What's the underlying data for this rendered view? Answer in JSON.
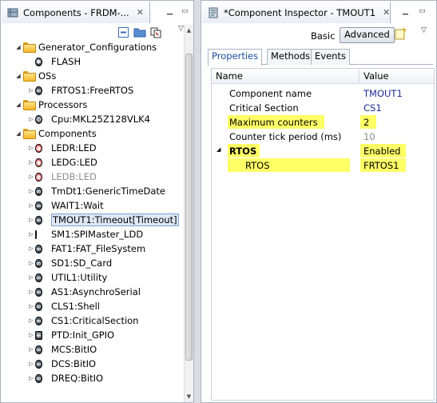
{
  "left_view": {
    "title": "Components - FRDM-...",
    "close": "✕",
    "toolbar_icons": [
      "collapse-all-icon",
      "folder-icon",
      "link-icon"
    ],
    "menu": "▽"
  },
  "tree": [
    {
      "label": "Generator_Configurations",
      "icon": "folder-icon",
      "expanded": true
    },
    {
      "label": "FLASH",
      "icon": "gear-icon"
    },
    {
      "label": "OSs",
      "icon": "folder-icon",
      "expanded": true
    },
    {
      "label": "FRTOS1:FreeRTOS",
      "icon": "component-icon",
      "expanded": false
    },
    {
      "label": "Processors",
      "icon": "folder-icon",
      "expanded": true
    },
    {
      "label": "Cpu:MKL25Z128VLK4",
      "icon": "cpu-icon",
      "expanded": false
    },
    {
      "label": "Components",
      "icon": "folder-icon",
      "expanded": true
    },
    {
      "label": "LEDR:LED",
      "icon": "led-icon",
      "expanded": false
    },
    {
      "label": "LEDG:LED",
      "icon": "led-icon",
      "expanded": false
    },
    {
      "label": "LEDB:LED",
      "icon": "led-icon",
      "expanded": false,
      "disabled": true
    },
    {
      "label": "TmDt1:GenericTimeDate",
      "icon": "component-icon",
      "expanded": false
    },
    {
      "label": "WAIT1:Wait",
      "icon": "component-icon",
      "expanded": false
    },
    {
      "label": "TMOUT1:Timeout[Timeout]",
      "icon": "component-icon",
      "expanded": false,
      "selected": true
    },
    {
      "label": "SM1:SPIMaster_LDD",
      "icon": "spi-icon",
      "expanded": false
    },
    {
      "label": "FAT1:FAT_FileSystem",
      "icon": "component-icon",
      "expanded": false
    },
    {
      "label": "SD1:SD_Card",
      "icon": "component-icon",
      "expanded": false
    },
    {
      "label": "UTIL1:Utility",
      "icon": "component-icon",
      "expanded": false
    },
    {
      "label": "AS1:AsynchroSerial",
      "icon": "component-icon",
      "expanded": false
    },
    {
      "label": "CLS1:Shell",
      "icon": "component-icon",
      "expanded": false
    },
    {
      "label": "CS1:CriticalSection",
      "icon": "component-icon",
      "expanded": false
    },
    {
      "label": "PTD:Init_GPIO",
      "icon": "gpio-icon",
      "expanded": false
    },
    {
      "label": "MCS:BitIO",
      "icon": "component-icon",
      "expanded": false
    },
    {
      "label": "DCS:BitIO",
      "icon": "component-icon",
      "expanded": false
    },
    {
      "label": "DREQ:BitIO",
      "icon": "component-icon",
      "expanded": false
    }
  ],
  "right_view": {
    "title": "*Component Inspector - TMOUT1",
    "close": "✕",
    "menu": "▽",
    "basic_label": "Basic",
    "advanced_label": "Advanced",
    "tabs": [
      "Properties",
      "Methods",
      "Events"
    ],
    "active_tab": "Properties",
    "columns": {
      "name": "Name",
      "value": "Value"
    },
    "properties": [
      {
        "name": "Component name",
        "value": "TMOUT1",
        "style": "blue"
      },
      {
        "name": "Critical Section",
        "value": "CS1",
        "style": "blue"
      },
      {
        "name": "Maximum counters",
        "value": "2",
        "style": "plain",
        "highlight": true
      },
      {
        "name": "Counter tick period (ms)",
        "value": "10",
        "style": "gray"
      },
      {
        "name": "RTOS",
        "value": "Enabled",
        "style": "plain",
        "highlight": true,
        "bold": true,
        "expanded": true
      },
      {
        "name": "RTOS",
        "value": "FRTOS1",
        "style": "plain",
        "highlight": true,
        "indent": true
      }
    ]
  },
  "colors": {
    "highlight": "#ffff66",
    "value_blue": "#1e2a96",
    "selection": "#dfe8f6"
  }
}
